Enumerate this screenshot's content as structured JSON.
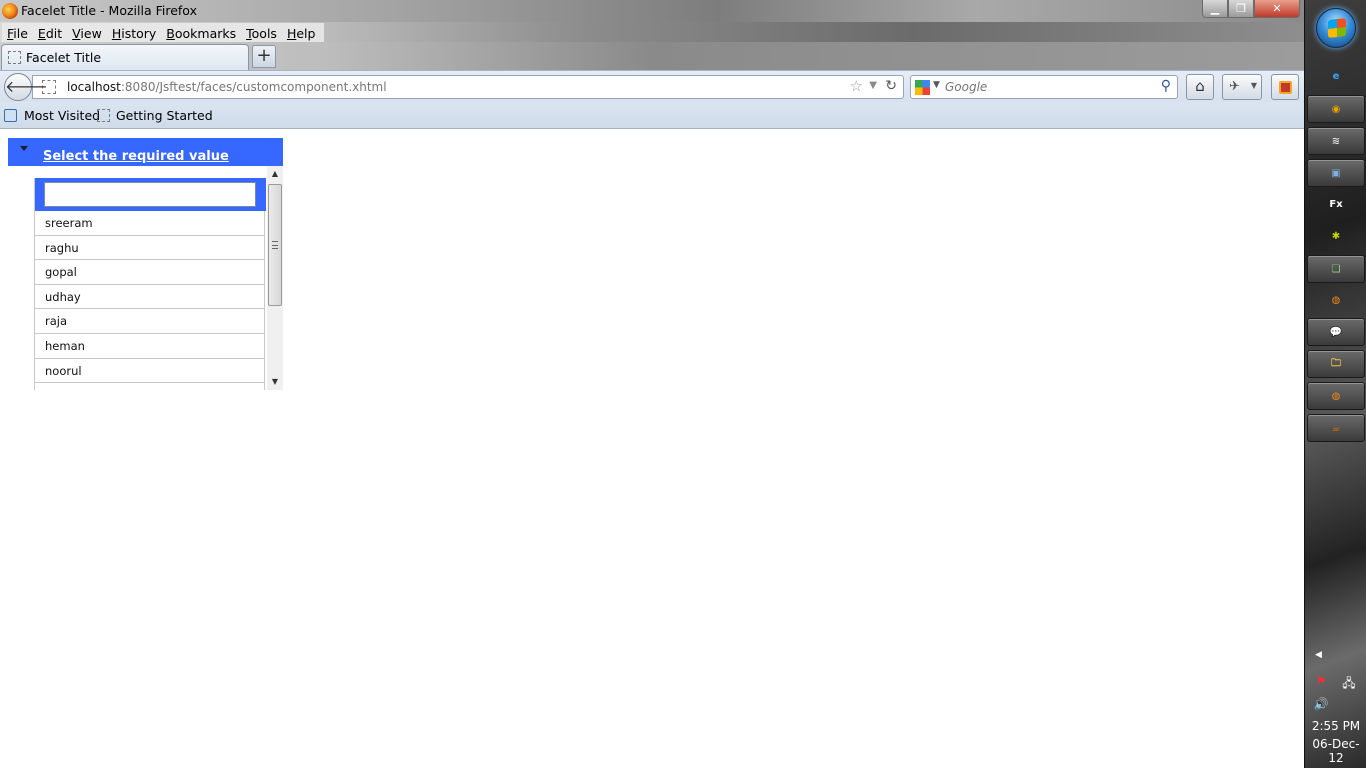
{
  "window": {
    "title": "Facelet Title - Mozilla Firefox",
    "controls": {
      "minimize": "▁",
      "maximize": "❐",
      "close": "✕"
    }
  },
  "menu": {
    "items": [
      {
        "label": "File",
        "accel": "F",
        "rest": "ile"
      },
      {
        "label": "Edit",
        "accel": "E",
        "rest": "dit"
      },
      {
        "label": "View",
        "accel": "V",
        "rest": "iew"
      },
      {
        "label": "History",
        "accel": "H",
        "rest": "istory"
      },
      {
        "label": "Bookmarks",
        "accel": "B",
        "rest": "ookmarks"
      },
      {
        "label": "Tools",
        "accel": "T",
        "rest": "ools"
      },
      {
        "label": "Help",
        "accel": "H",
        "rest": "elp"
      }
    ]
  },
  "tabs": {
    "active_title": "Facelet Title",
    "new_tab": "+"
  },
  "navbar": {
    "back": "🡐",
    "url_host": "localhost",
    "url_rest": ":8080/Jsftest/faces/customcomponent.xhtml",
    "star": "☆",
    "dropdown": "▼",
    "reload": "↻",
    "search_placeholder": "Google",
    "search_go": "⚲",
    "home": "⌂",
    "addon_icon": "✈",
    "addon_drop": "▼"
  },
  "bookmarks": {
    "most_visited": "Most Visited",
    "getting_started": "Getting Started"
  },
  "panel": {
    "title": "Select the required value",
    "filter_value": "",
    "items": [
      "sreeram",
      "raghu",
      "gopal",
      "udhay",
      "raja",
      "heman",
      "noorul",
      ""
    ],
    "scroll_up": "▲",
    "scroll_down": "▼"
  },
  "taskbar": {
    "buttons": [
      {
        "name": "ie",
        "glyph": "e",
        "color": "#3aa0ff",
        "framed": false
      },
      {
        "name": "chrome",
        "glyph": "◉",
        "color": "#e5a400",
        "framed": true
      },
      {
        "name": "app-waves",
        "glyph": "≋",
        "color": "#dddddd",
        "framed": true
      },
      {
        "name": "virtualbox",
        "glyph": "▣",
        "color": "#7fb0e0",
        "framed": true
      },
      {
        "name": "fx",
        "glyph": "Fx",
        "color": "#ffffff",
        "framed": false
      },
      {
        "name": "bug-app",
        "glyph": "✱",
        "color": "#c6d600",
        "framed": false
      },
      {
        "name": "windows-explorer-green",
        "glyph": "❏",
        "color": "#8bd37a",
        "framed": true
      },
      {
        "name": "firefox-pinned",
        "glyph": "◍",
        "color": "#f08a1c",
        "framed": false
      },
      {
        "name": "chat",
        "glyph": "💬",
        "color": "#ffffff",
        "framed": true
      },
      {
        "name": "folder",
        "glyph": "🗀",
        "color": "#f2c14e",
        "framed": true
      },
      {
        "name": "firefox-active",
        "glyph": "◍",
        "color": "#f08a1c",
        "framed": true
      },
      {
        "name": "java",
        "glyph": "☕",
        "color": "#e76f00",
        "framed": true
      }
    ],
    "tray_arrow": "◀",
    "tray_flag": "⚑",
    "tray_network": "🖧",
    "tray_volume": "🔊",
    "time": "2:55 PM",
    "date": "06-Dec-12"
  }
}
